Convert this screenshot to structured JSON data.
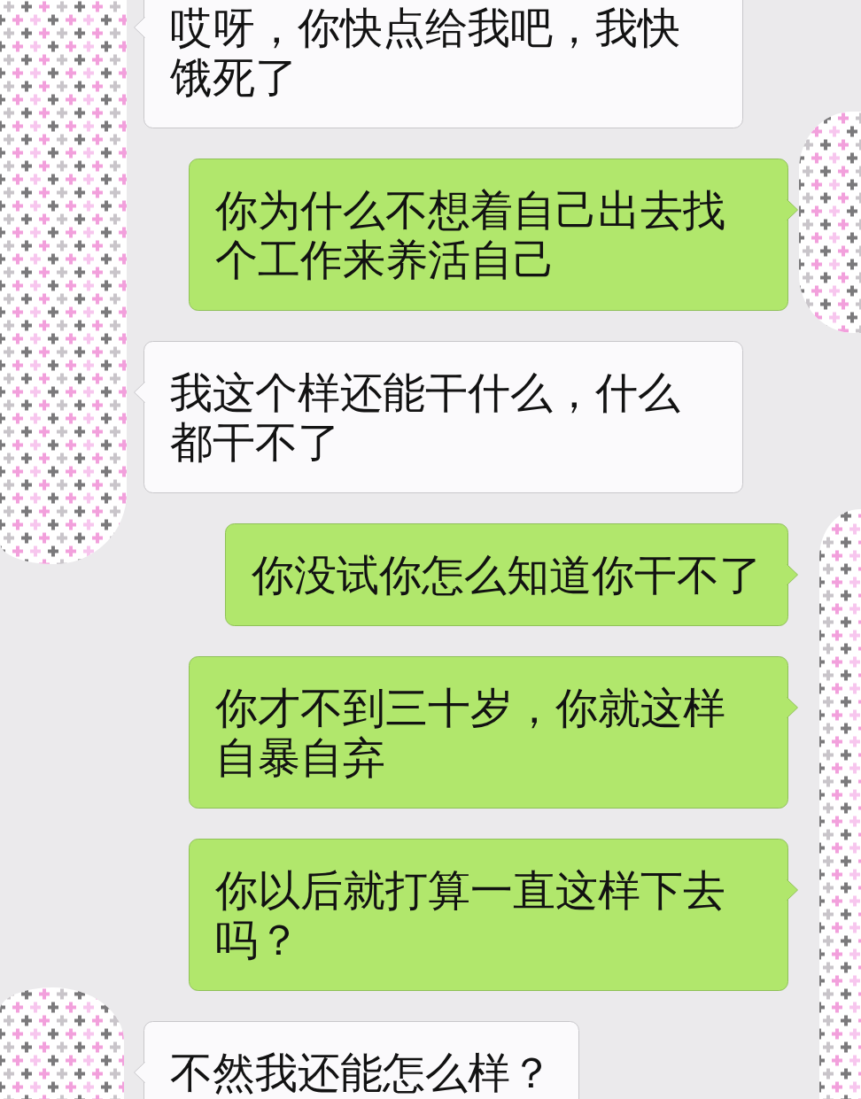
{
  "messages": [
    {
      "kind": "received",
      "text": "哎呀，你快点给我吧，我快饿死了"
    },
    {
      "kind": "sent",
      "text": "你为什么不想着自己出去找个工作来养活自己"
    },
    {
      "kind": "received",
      "text": "我这个样还能干什么，什么都干不了"
    },
    {
      "kind": "sent",
      "text": "你没试你怎么知道你干不了"
    },
    {
      "kind": "sent",
      "text": "你才不到三十岁，你就这样自暴自弃"
    },
    {
      "kind": "sent",
      "text": "你以后就打算一直这样下去吗？"
    },
    {
      "kind": "received",
      "text": "不然我还能怎么样？"
    }
  ]
}
